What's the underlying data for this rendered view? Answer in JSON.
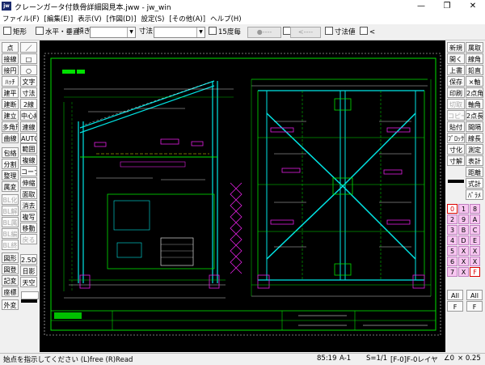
{
  "window": {
    "title": "クレーンガータ付鉄骨詳細図見本.jww - jw_win",
    "icon": "jw",
    "minimize": "—",
    "maximize": "❐",
    "close": "✕"
  },
  "menu": [
    "ファイル(F)",
    "[編集(E)]",
    "表示(V)",
    "[作図(D)]",
    "設定(S)",
    "[その他(A)]",
    "ヘルプ(H)"
  ],
  "toolbar": {
    "rect": "矩形",
    "hv": "水平・垂直",
    "tilt": "傾き",
    "dim": "寸法",
    "deg15": "15度毎",
    "btn1": "●----",
    "btn2": "<----",
    "dimval": "寸法値",
    "lt": "<"
  },
  "left_tools": [
    [
      "点",
      "／"
    ],
    [
      "接線",
      "□"
    ],
    [
      "接円",
      "○"
    ],
    [
      "ﾊｯﾁ",
      "文字"
    ],
    [
      "建平",
      "寸法"
    ],
    [
      "建断",
      "2線"
    ],
    [
      "建立",
      "中心線"
    ],
    [
      "多角形",
      "連線"
    ],
    [
      "曲線",
      "AUTO"
    ],
    [
      "包絡",
      "範囲"
    ],
    [
      "分割",
      "複線"
    ],
    [
      "整理",
      "コーナー"
    ],
    [
      "属変",
      "伸縮"
    ],
    [
      "BL化",
      "面取"
    ],
    [
      "BL解",
      "消去"
    ],
    [
      "BL属",
      "複写"
    ],
    [
      "BL編",
      "移動"
    ],
    [
      "BL終",
      "戻る"
    ],
    [
      "図形",
      "2.5D"
    ],
    [
      "図登",
      "日影"
    ],
    [
      "記変",
      "天空"
    ],
    [
      "座標",
      ""
    ],
    [
      "外変",
      ""
    ]
  ],
  "right_tools": [
    [
      "新規",
      "属取"
    ],
    [
      "開く",
      "線角"
    ],
    [
      "上書",
      "鉛直"
    ],
    [
      "保存",
      "×軸"
    ],
    [
      "印刷",
      "2点角"
    ],
    [
      "切取",
      "軸角"
    ],
    [
      "コピー",
      "2点長"
    ],
    [
      "貼付",
      "間隔"
    ],
    [
      "",
      "線長"
    ],
    [
      "ﾌﾞﾛｯｸ",
      "測定"
    ],
    [
      "寸化",
      "表計"
    ],
    [
      "寸解",
      "距離"
    ],
    [
      "",
      "式計"
    ],
    [
      "",
      "ﾊﾟﾗﾒ"
    ]
  ],
  "layers": {
    "groups": [
      "0",
      "1",
      "2",
      "3",
      "4",
      "5",
      "6",
      "7",
      "8",
      "9",
      "A",
      "B",
      "C",
      "D",
      "E",
      "F"
    ],
    "all": "All",
    "f": "F",
    "x": "X"
  },
  "status": {
    "prompt": "始点を指示してください (L)free (R)Read",
    "coord": "85:19",
    "paper": "A-1",
    "scale": "S=1/1",
    "layer": "[F-0]F-0レイヤ",
    "zoom": "∠0",
    "ratio": "× 0.25"
  },
  "colors": {
    "canvas": "#000000",
    "green": "#00e000",
    "cyan": "#00e5e5",
    "magenta": "#e020e0",
    "white": "#ffffff",
    "yellow": "#e6e600",
    "layer_bg": "#f7c6f0"
  }
}
